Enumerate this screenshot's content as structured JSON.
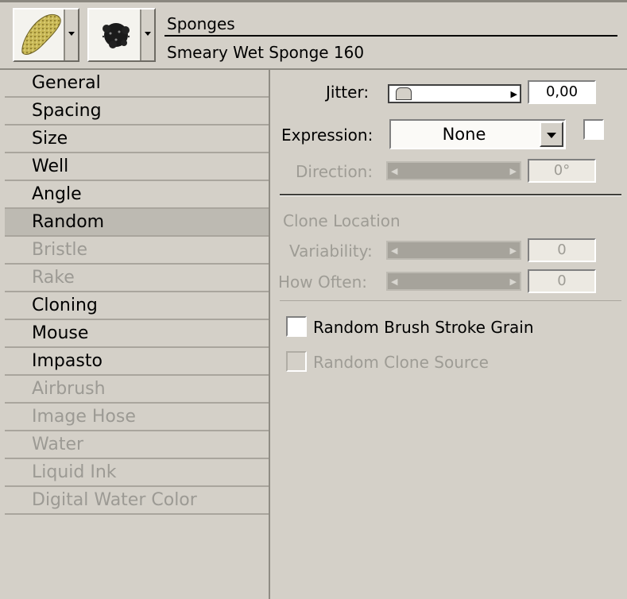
{
  "header": {
    "category": "Sponges",
    "variant": "Smeary Wet Sponge 160"
  },
  "categories": [
    {
      "label": "General",
      "enabled": true
    },
    {
      "label": "Spacing",
      "enabled": true
    },
    {
      "label": "Size",
      "enabled": true
    },
    {
      "label": "Well",
      "enabled": true
    },
    {
      "label": "Angle",
      "enabled": true
    },
    {
      "label": "Random",
      "enabled": true,
      "selected": true
    },
    {
      "label": "Bristle",
      "enabled": false
    },
    {
      "label": "Rake",
      "enabled": false
    },
    {
      "label": "Cloning",
      "enabled": true
    },
    {
      "label": "Mouse",
      "enabled": true
    },
    {
      "label": "Impasto",
      "enabled": true
    },
    {
      "label": "Airbrush",
      "enabled": false
    },
    {
      "label": "Image Hose",
      "enabled": false
    },
    {
      "label": "Water",
      "enabled": false
    },
    {
      "label": "Liquid Ink",
      "enabled": false
    },
    {
      "label": "Digital Water Color",
      "enabled": false
    }
  ],
  "random": {
    "jitter_label": "Jitter:",
    "jitter_value": "0,00",
    "expression_label": "Expression:",
    "expression_value": "None",
    "direction_label": "Direction:",
    "direction_value": "0°",
    "clone_location_label": "Clone Location",
    "variability_label": "Variability:",
    "variability_value": "0",
    "how_often_label": "How Often:",
    "how_often_value": "0",
    "random_grain_label": "Random Brush Stroke Grain",
    "random_grain_checked": false,
    "random_clone_label": "Random Clone Source",
    "random_clone_checked": false
  },
  "icons": {
    "variant_preview": "sponge-icon",
    "dab_preview": "dab-icon",
    "dropdown": "chevron-down-icon",
    "slider_left": "arrow-left-icon",
    "slider_right": "arrow-right-icon"
  },
  "colors": {
    "panel_bg": "#d4d0c8",
    "selected_row": "#bdbab2",
    "disabled_text": "#9c9a94"
  }
}
